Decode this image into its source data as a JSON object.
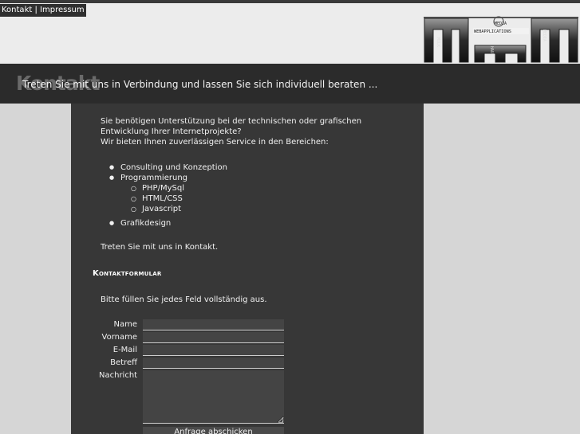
{
  "nav": {
    "kontakt": "Kontakt",
    "sep": "|",
    "impressum": "Impressum"
  },
  "logo": {
    "text_top": "MEDIA",
    "text_mid": "WEBAPPLICATIONS",
    "text_left": "MILK",
    "text_bottom": "HAU",
    "text_right": "MEDIA"
  },
  "banner": {
    "title": "Kontakt",
    "tagline": "Treten Sie mit uns in Verbindung und lassen Sie sich individuell beraten ..."
  },
  "intro": {
    "line1": "Sie benötigen Unterstützung bei der technischen oder grafischen",
    "line2": "Entwicklung Ihrer Internetprojekte?",
    "line3": "Wir bieten Ihnen zuverlässigen Service in den Bereichen:"
  },
  "services": {
    "items": [
      "Consulting und Konzeption",
      "Programmierung",
      "Grafikdesign"
    ],
    "sub": [
      "PHP/MySql",
      "HTML/CSS",
      "Javascript"
    ]
  },
  "contact_line": "Treten Sie mit uns in Kontakt.",
  "form": {
    "title": "Kontaktformular",
    "hint": "Bitte füllen Sie jedes Feld vollständig aus.",
    "labels": {
      "name": "Name",
      "vorname": "Vorname",
      "email": "E-Mail",
      "betreff": "Betreff",
      "nachricht": "Nachricht"
    },
    "submit": "Anfrage abschicken"
  }
}
